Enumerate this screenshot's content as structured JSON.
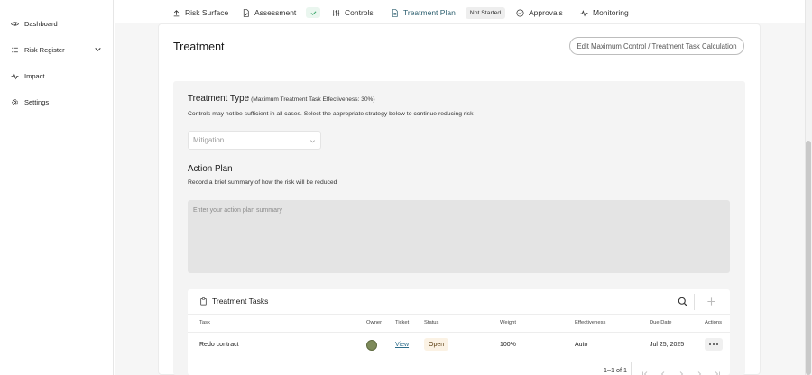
{
  "sidebar": {
    "items": [
      {
        "label": "Dashboard",
        "icon": "eye-icon"
      },
      {
        "label": "Risk Register",
        "icon": "list-icon"
      },
      {
        "label": "Impact",
        "icon": "activity-icon"
      },
      {
        "label": "Settings",
        "icon": "gear-icon"
      }
    ]
  },
  "tabs": [
    {
      "label": "Risk Surface",
      "icon": "upload-icon"
    },
    {
      "label": "Assessment",
      "icon": "document-check-icon"
    },
    {
      "label": "Controls",
      "icon": "sliders-icon"
    },
    {
      "label": "Treatment Plan",
      "icon": "document-icon",
      "badge": "Not Started",
      "active": true
    },
    {
      "label": "Approvals",
      "icon": "check-circle-icon"
    },
    {
      "label": "Monitoring",
      "icon": "pulse-icon"
    }
  ],
  "page": {
    "title": "Treatment",
    "edit_button": "Edit Maximum Control / Treatment Task Calculation"
  },
  "treatment_type": {
    "title": "Treatment Type",
    "subtitle": "(Maximum Treatment Task Effectiveness: 30%)",
    "description": "Controls may not be sufficient in all cases. Select the appropriate strategy below to continue reducing risk",
    "select_placeholder": "Mitigation"
  },
  "action_plan": {
    "title": "Action Plan",
    "description": "Record a brief summary of how the risk will be reduced",
    "placeholder": "Enter your action plan summary"
  },
  "tasks": {
    "title": "Treatment Tasks",
    "columns": [
      "Task",
      "Owner",
      "Ticket",
      "Status",
      "Weight",
      "Effectiveness",
      "Due Date",
      "Actions"
    ],
    "rows": [
      {
        "task": "Redo contract",
        "ticket": "View",
        "status": "Open",
        "weight": "100%",
        "effectiveness": "Auto",
        "due_date": "Jul 25, 2025"
      }
    ],
    "pagination": "1–1 of 1"
  },
  "colors": {
    "accent": "#2d5f6f",
    "success": "#3aa56a",
    "status_open_bg": "#fbf2e4"
  }
}
